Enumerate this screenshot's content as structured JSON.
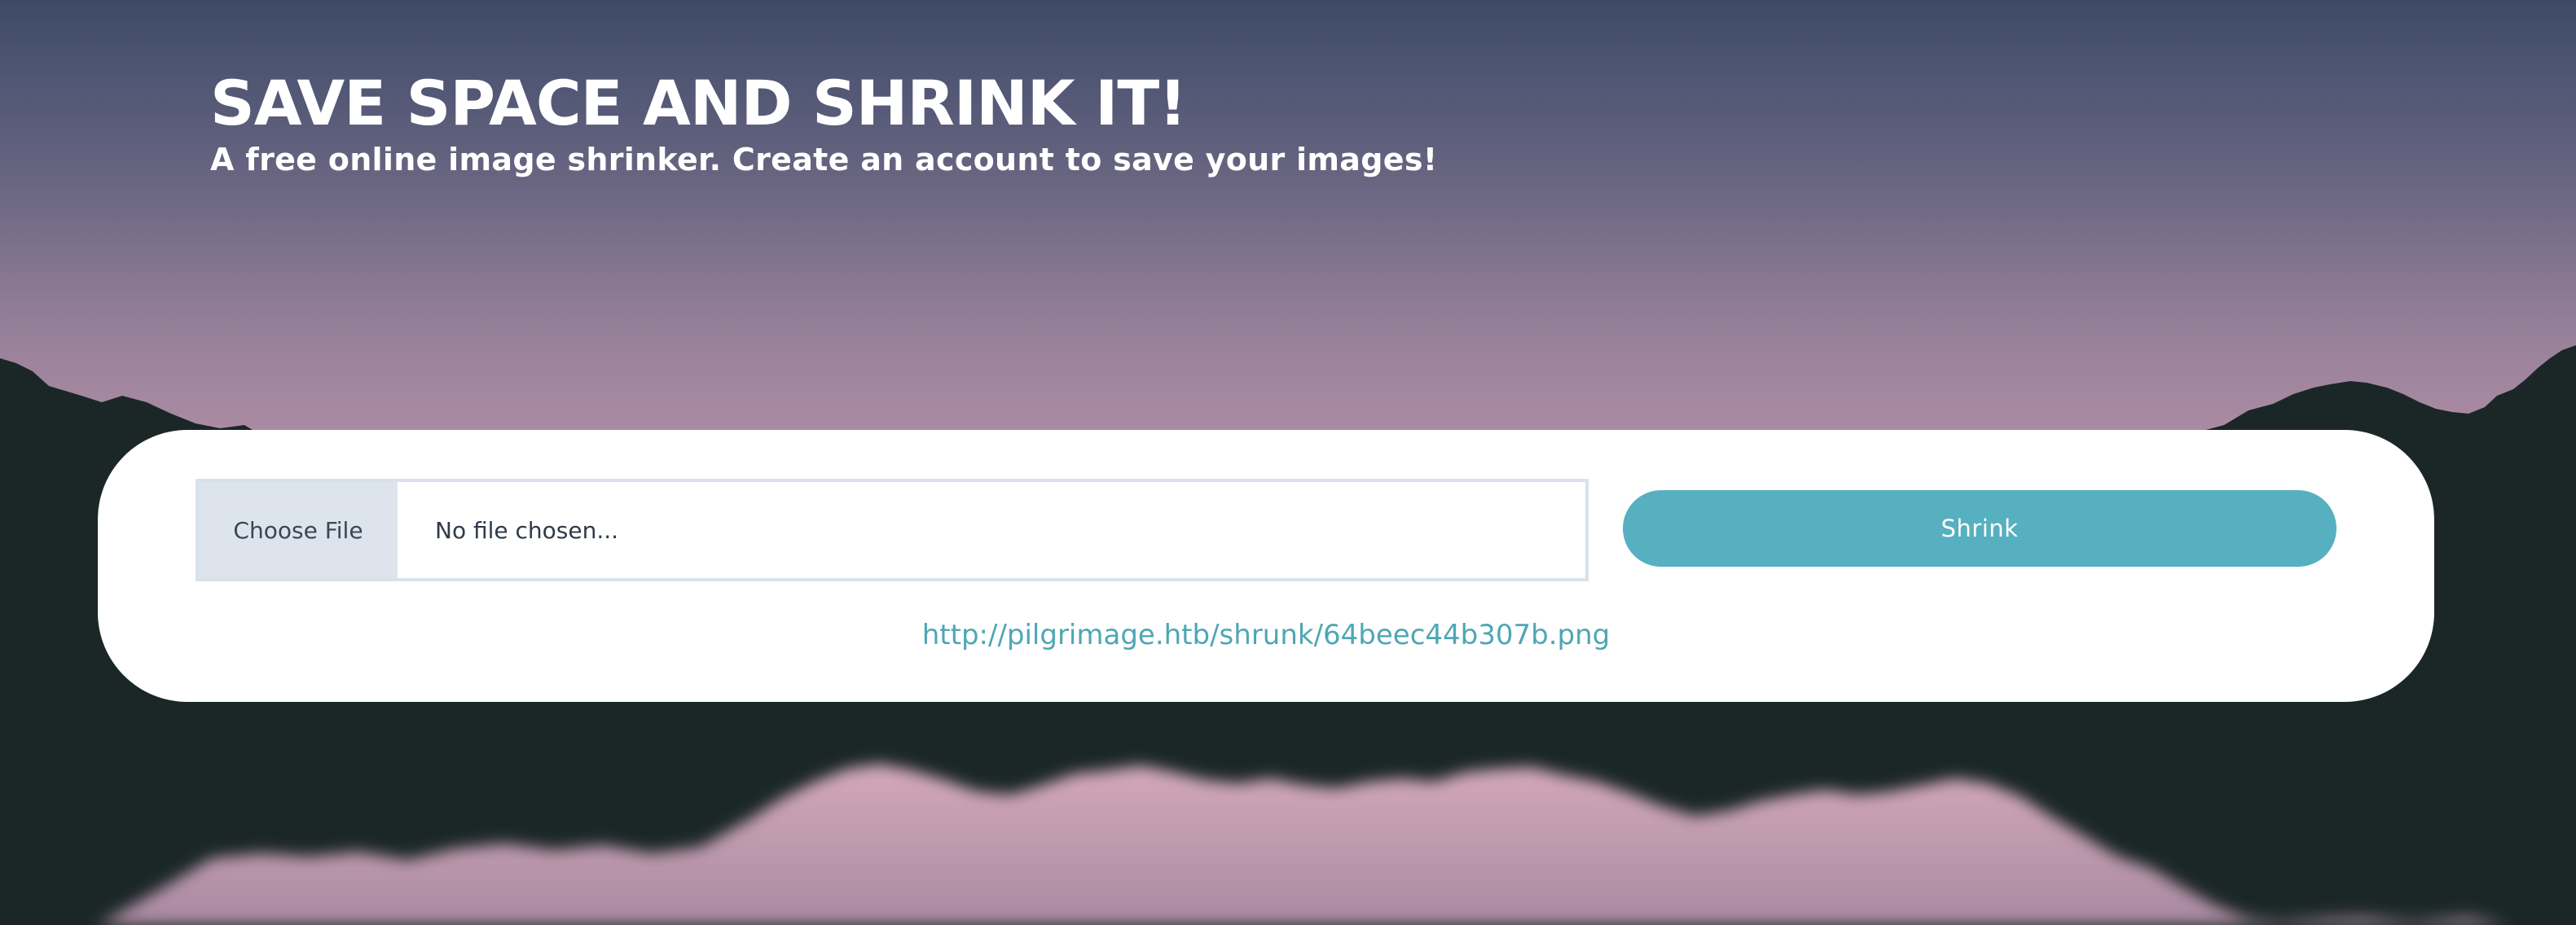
{
  "hero": {
    "title": "SAVE SPACE AND SHRINK IT!",
    "subtitle": "A free online image shrinker. Create an account to save your images!"
  },
  "upload_form": {
    "choose_file_label": "Choose File",
    "file_status": "No file chosen...",
    "submit_label": "Shrink"
  },
  "result": {
    "link_text": "http://pilgrimage.htb/shrunk/64beec44b307b.png"
  },
  "colors": {
    "sky_top": "#3c4a68",
    "sky_bottom": "#aa8aa3",
    "mountains": "#1b2727",
    "reflection": "#d3a7b8",
    "accent": "#56b0bf",
    "panel": "#ffffff"
  }
}
